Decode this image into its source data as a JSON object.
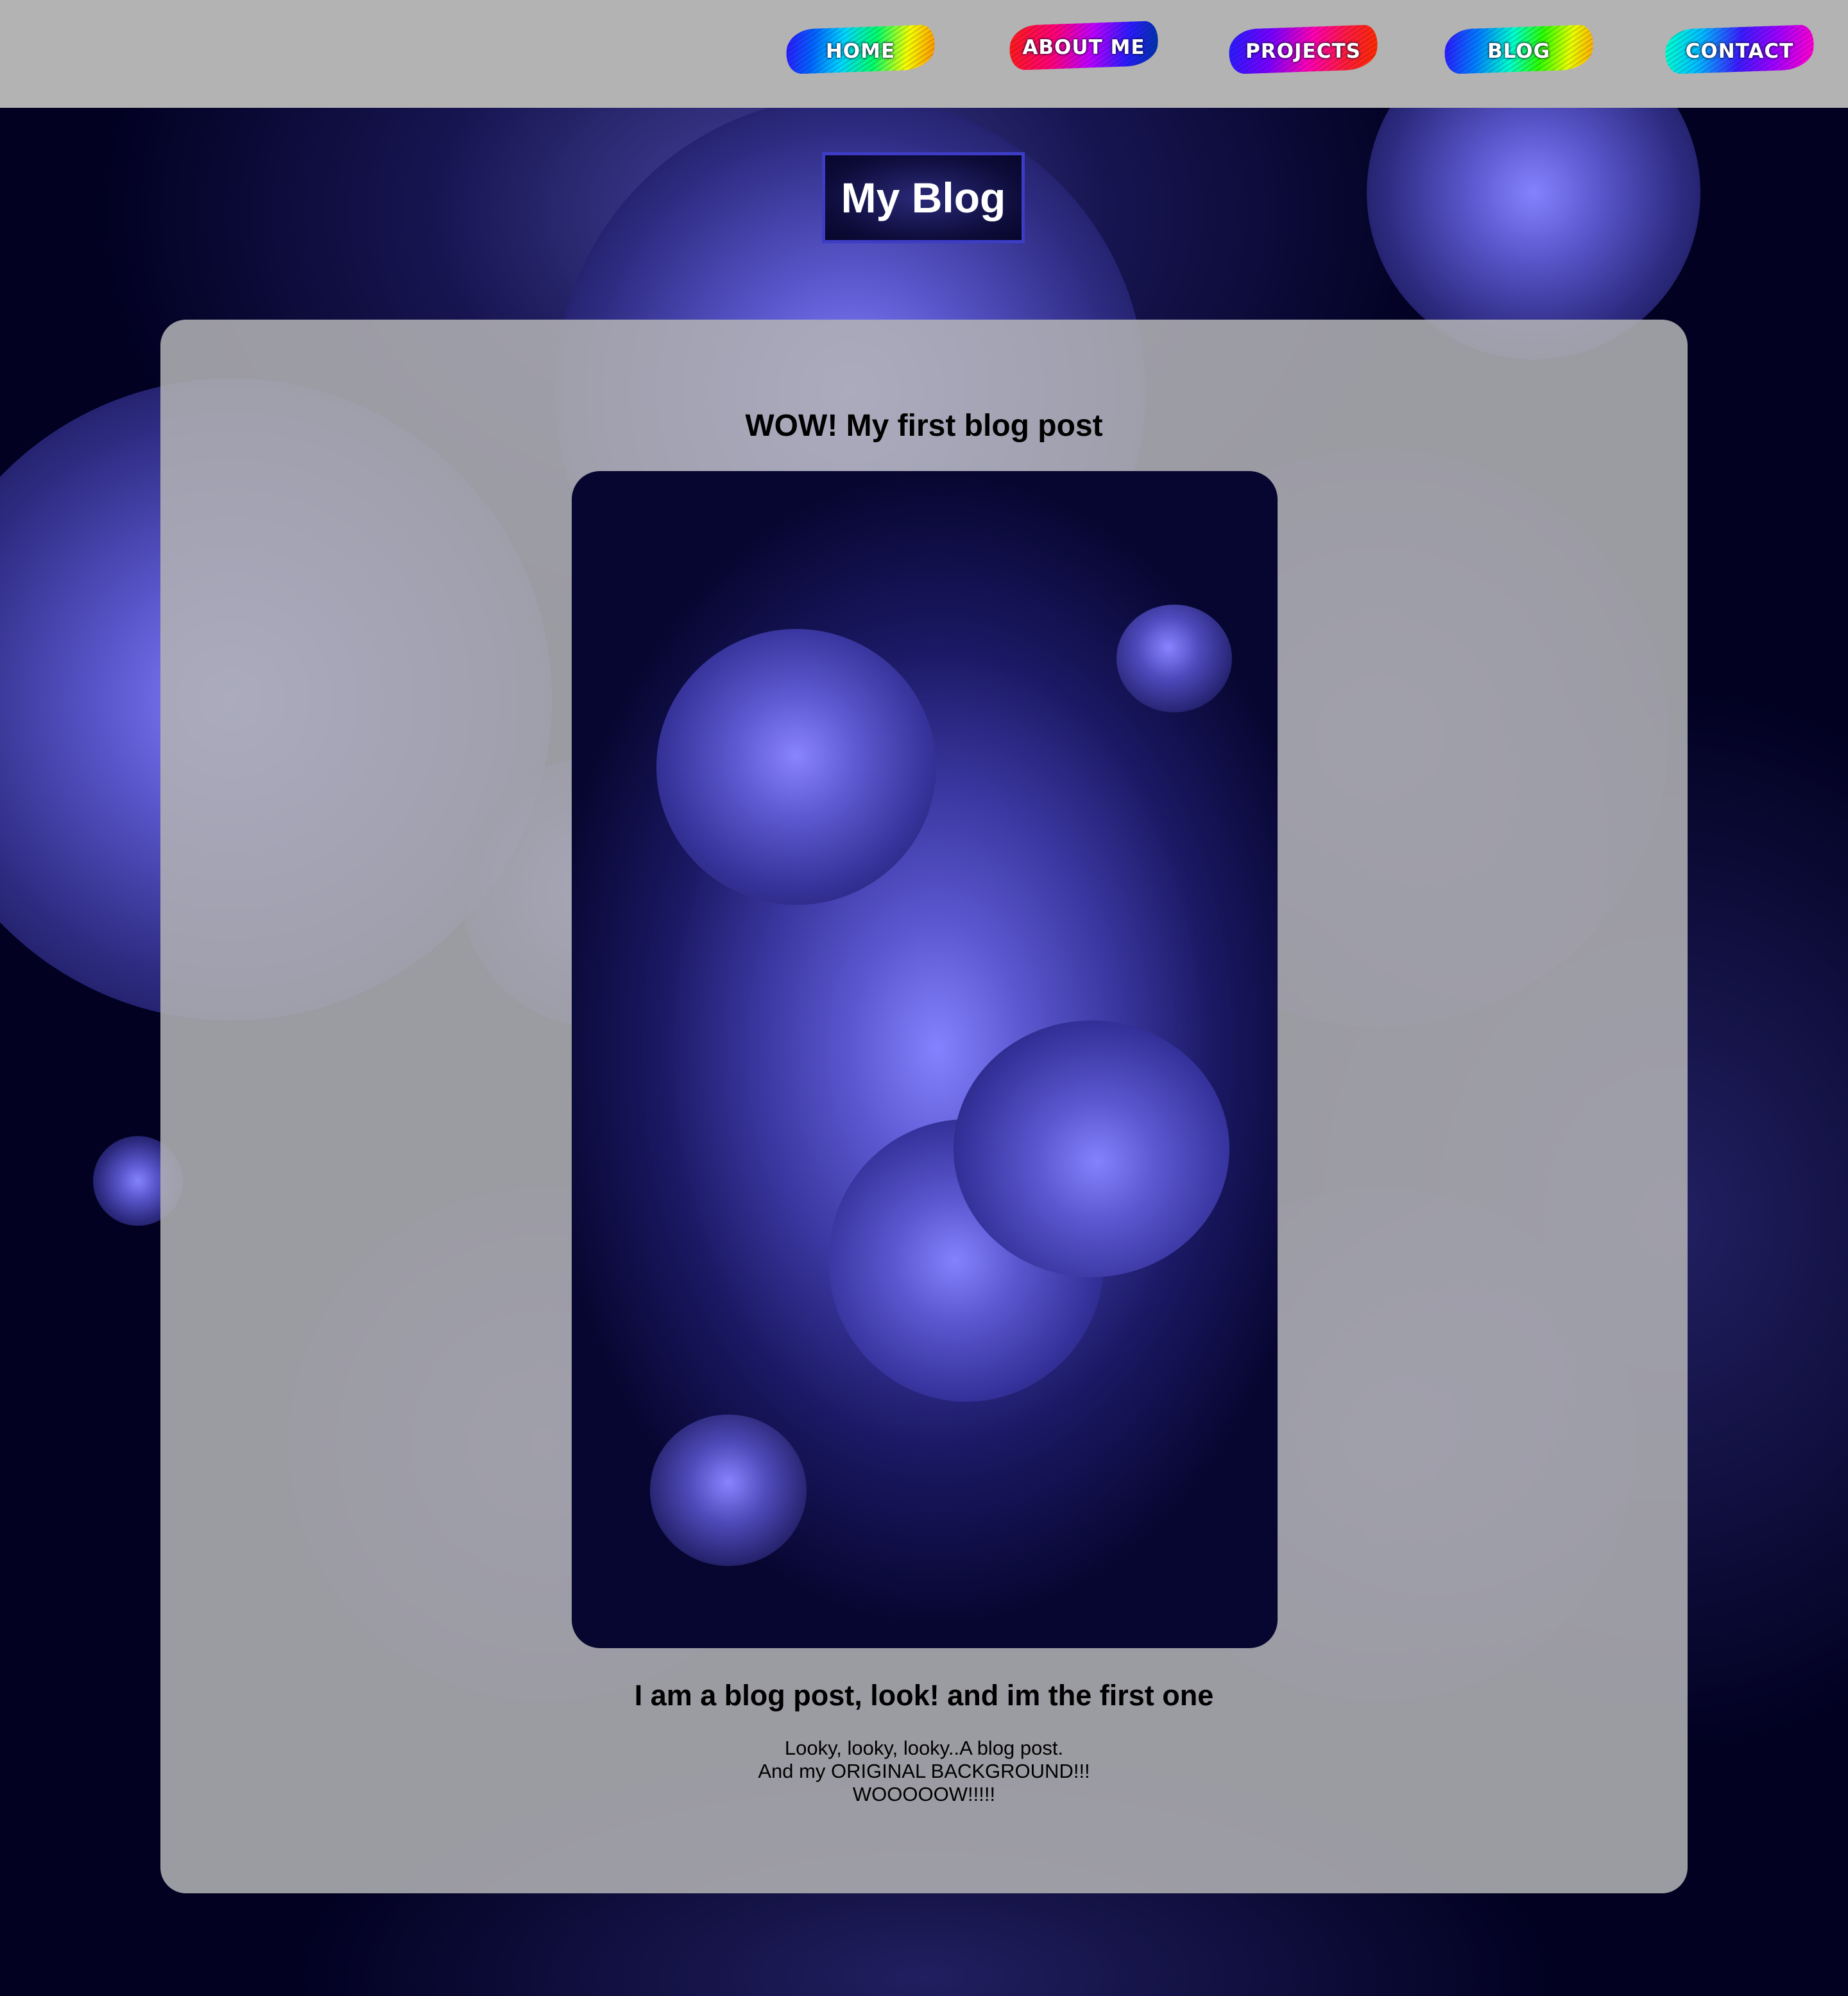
{
  "nav": {
    "items": [
      {
        "label": "HOME"
      },
      {
        "label": "ABOUT ME"
      },
      {
        "label": "PROJECTS"
      },
      {
        "label": "BLOG"
      },
      {
        "label": "CONTACT"
      }
    ]
  },
  "page": {
    "title": "My Blog"
  },
  "post": {
    "title": "WOW! My first blog post",
    "subtitle": "I am a blog post, look! and im the first one",
    "body_lines": [
      "Looky, looky, looky..A blog post.",
      "And my ORIGINAL BACKGROUND!!!",
      "WOOOOOW!!!!!"
    ]
  },
  "colors": {
    "nav_bar": "#b3b3b3",
    "background": "#020122",
    "orb_highlight": "#8582ff",
    "title_border": "#3c3cc4",
    "card": "#b0b0b4"
  }
}
